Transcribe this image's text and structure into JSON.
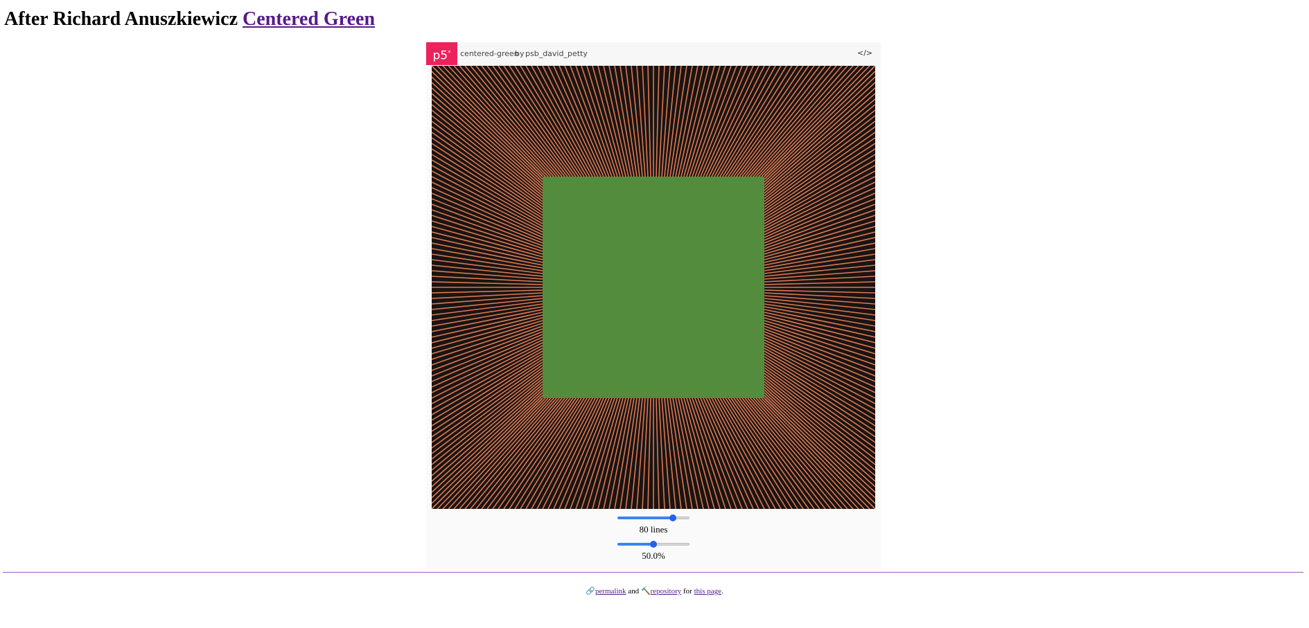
{
  "page": {
    "heading_prefix": "After Richard Anuszkiewicz",
    "heading_link": "Centered Green"
  },
  "embed": {
    "logo": "p5",
    "logo_sup": "*",
    "sketch_name": "centered-green",
    "by": "by",
    "author": "psb_david_petty",
    "code_icon": "</>"
  },
  "canvas": {
    "background": "#1b1412",
    "line_color": "#d97a55",
    "square_color": "#538c3c",
    "lines_per_side": 80,
    "square_fraction": 0.5
  },
  "controls": {
    "lines_slider_value": 0.77,
    "lines_label": "80 lines",
    "size_slider_value": 0.5,
    "size_label": "50.0%"
  },
  "footer": {
    "icon1": "🔗",
    "permalink": "permalink",
    "and": "and",
    "icon2": "🔨",
    "repository": "repository",
    "for": "for",
    "this_page": "this page",
    "period": "."
  },
  "colors": {
    "link": "#551a8b",
    "accent": "#ed225d",
    "slider": "#2563eb",
    "rule": "#9b59c6"
  }
}
